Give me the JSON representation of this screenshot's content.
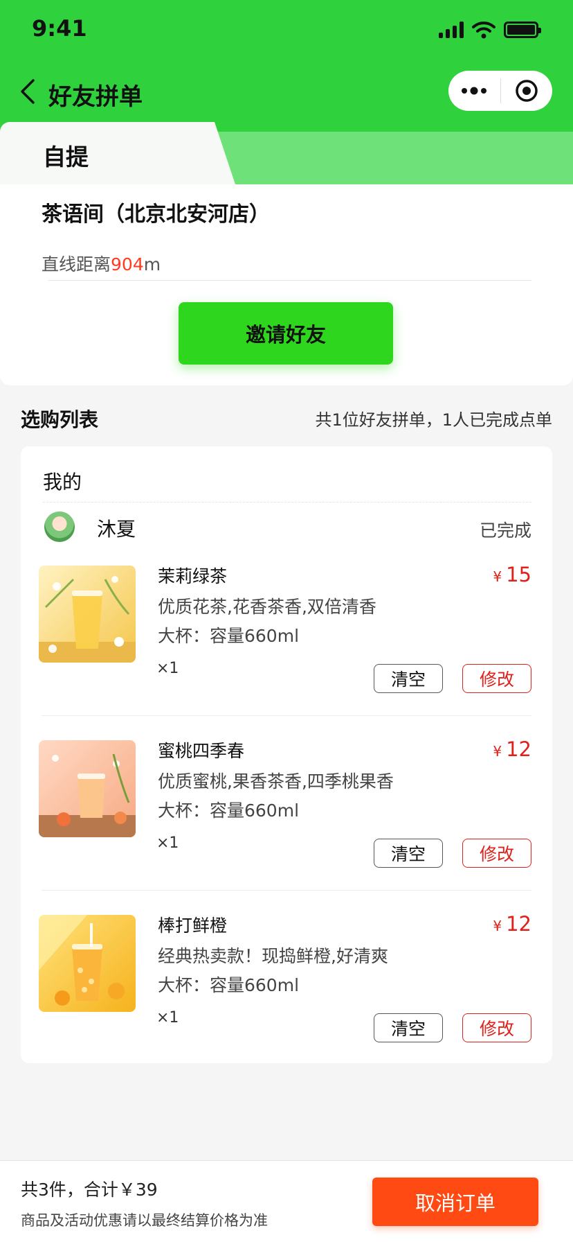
{
  "status_bar": {
    "time": "9:41"
  },
  "nav": {
    "title": "好友拼单"
  },
  "tabs": [
    {
      "label": "自提",
      "active": true
    },
    {
      "label": "",
      "active": false
    }
  ],
  "store": {
    "name": "茶语间（北京北安河店）",
    "distance_label": "直线距离",
    "distance_value": "904",
    "distance_unit": "m",
    "invite_label": "邀请好友"
  },
  "list": {
    "title": "选购列表",
    "summary": "共1位好友拼单，1人已完成点单",
    "section_label": "我的",
    "user": {
      "name": "沐夏",
      "status": "已完成"
    },
    "items": [
      {
        "name": "茉莉绿茶",
        "currency": "¥",
        "price": "15",
        "desc": "优质花茶,花香茶香,双倍清香",
        "spec": "大杯：容量660ml",
        "qty": "×1",
        "clear_label": "清空",
        "edit_label": "修改"
      },
      {
        "name": "蜜桃四季春",
        "currency": "¥",
        "price": "12",
        "desc": "优质蜜桃,果香茶香,四季桃果香",
        "spec": "大杯：容量660ml",
        "qty": "×1",
        "clear_label": "清空",
        "edit_label": "修改"
      },
      {
        "name": "棒打鲜橙",
        "currency": "¥",
        "price": "12",
        "desc": "经典热卖款！现捣鲜橙,好清爽",
        "spec": "大杯：容量660ml",
        "qty": "×1",
        "clear_label": "清空",
        "edit_label": "修改"
      }
    ]
  },
  "bottom": {
    "total": "共3件，合计￥39",
    "note": "商品及活动优惠请以最终结算价格为准",
    "cancel_label": "取消订单"
  },
  "colors": {
    "brand_green": "#2fd13d",
    "invite_green": "#2fd61e",
    "price_red": "#e0201a",
    "cancel_orange": "#ff4a14"
  },
  "icons": [
    "back-chevron-icon",
    "more-dots-icon",
    "close-target-icon",
    "signal-icon",
    "wifi-icon",
    "battery-icon"
  ]
}
